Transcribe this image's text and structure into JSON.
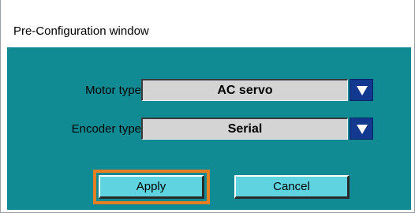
{
  "window": {
    "title": "Pre-Configuration window"
  },
  "form": {
    "motor": {
      "label": "Motor type",
      "value": "AC servo"
    },
    "encoder": {
      "label": "Encoder type",
      "value": "Serial"
    }
  },
  "buttons": {
    "apply": "Apply",
    "cancel": "Cancel"
  },
  "icons": {
    "dropdown": "chevron-down-icon"
  },
  "colors": {
    "client_bg": "#118b93",
    "dropdown_button": "#13388f",
    "button_face": "#5fd4e0",
    "focus_ring": "#e67e22"
  }
}
